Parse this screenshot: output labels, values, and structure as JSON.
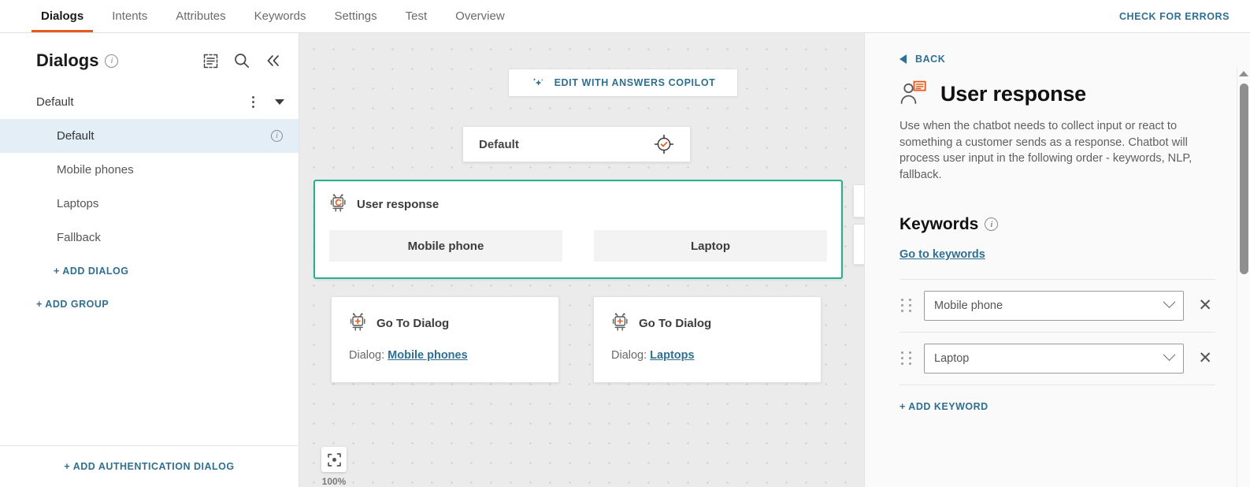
{
  "topbar": {
    "tabs": [
      {
        "label": "Dialogs",
        "active": true
      },
      {
        "label": "Intents",
        "active": false
      },
      {
        "label": "Attributes",
        "active": false
      },
      {
        "label": "Keywords",
        "active": false
      },
      {
        "label": "Settings",
        "active": false
      },
      {
        "label": "Test",
        "active": false
      },
      {
        "label": "Overview",
        "active": false
      }
    ],
    "check_errors_label": "CHECK FOR ERRORS"
  },
  "sidebar": {
    "title": "Dialogs",
    "info_glyph": "i",
    "icons": [
      "list-select-icon",
      "search-icon",
      "collapse-icon"
    ],
    "group": {
      "name": "Default",
      "kebab": "more-options-icon",
      "caret": "chevron-down-icon"
    },
    "items": [
      {
        "label": "Default",
        "selected": true,
        "info": "i"
      },
      {
        "label": "Mobile phones",
        "selected": false
      },
      {
        "label": "Laptops",
        "selected": false
      },
      {
        "label": "Fallback",
        "selected": false
      }
    ],
    "add_dialog_label": "+ ADD DIALOG",
    "add_group_label": "+ ADD GROUP",
    "add_auth_dialog_label": "+ ADD AUTHENTICATION DIALOG"
  },
  "canvas": {
    "copilot_button": "EDIT WITH ANSWERS COPILOT",
    "nodes": {
      "default": {
        "title": "Default",
        "icon": "target-check-icon"
      },
      "user_response": {
        "title": "User response",
        "icon": "robot-response-icon",
        "chips": [
          "Mobile phone",
          "Laptop"
        ]
      },
      "goto_a": {
        "title": "Go To Dialog",
        "icon": "robot-plus-icon",
        "field_label": "Dialog:",
        "field_value": "Mobile phones"
      },
      "goto_b": {
        "title": "Go To Dialog",
        "icon": "robot-plus-icon",
        "field_label": "Dialog:",
        "field_value": "Laptops"
      }
    },
    "zoom": {
      "icon": "fit-to-screen-icon",
      "level": "100%"
    }
  },
  "right_panel": {
    "back_label": "BACK",
    "title": "User response",
    "title_icon": "user-response-icon",
    "description": "Use when the chatbot needs to collect input or react to something a customer sends as a response. Chatbot will process user input in the following order - keywords, NLP, fallback.",
    "section_title": "Keywords",
    "section_info": "i",
    "go_to_keywords_label": "Go to keywords",
    "keywords": [
      {
        "value": "Mobile phone"
      },
      {
        "value": "Laptop"
      }
    ],
    "add_keyword_label": "+ ADD KEYWORD"
  },
  "colors": {
    "accent_orange": "#e8591f",
    "link_blue": "#2f6f91",
    "selected_teal": "#22b08d",
    "selected_row": "#e3eef7"
  }
}
